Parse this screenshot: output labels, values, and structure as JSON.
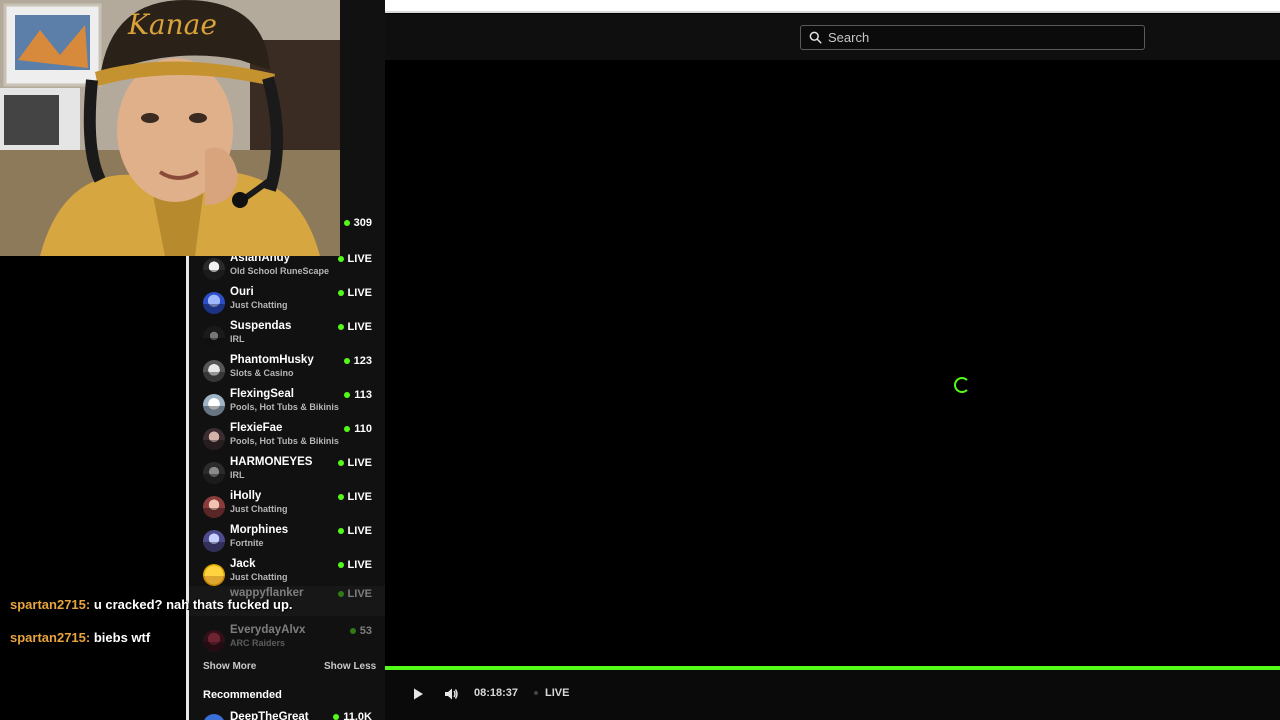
{
  "browser": {
    "url_fragment": "flanker"
  },
  "search": {
    "placeholder": "Search"
  },
  "top_row": {
    "viewers": "309",
    "dot_color": "#53fc18"
  },
  "following": [
    {
      "name": "AsianAndy",
      "category": "Old School RuneScape",
      "status": "LIVE"
    },
    {
      "name": "Ouri",
      "category": "Just Chatting",
      "status": "LIVE"
    },
    {
      "name": "Suspendas",
      "category": "IRL",
      "status": "LIVE"
    },
    {
      "name": "PhantomHusky",
      "category": "Slots & Casino",
      "status": "123"
    },
    {
      "name": "FlexingSeal",
      "category": "Pools, Hot Tubs & Bikinis",
      "status": "113"
    },
    {
      "name": "FlexieFae",
      "category": "Pools, Hot Tubs & Bikinis",
      "status": "110"
    },
    {
      "name": "HARMONEYES",
      "category": "IRL",
      "status": "LIVE"
    },
    {
      "name": "iHolly",
      "category": "Just Chatting",
      "status": "LIVE"
    },
    {
      "name": "Morphines",
      "category": "Fortnite",
      "status": "LIVE"
    },
    {
      "name": "Jack",
      "category": "Just Chatting",
      "status": "LIVE"
    },
    {
      "name": "wappyflanker",
      "category": "",
      "status": "LIVE"
    },
    {
      "name": "EverydayAlvx",
      "category": "ARC Raiders",
      "status": "53"
    }
  ],
  "sidebar": {
    "show_more": "Show More",
    "show_less": "Show Less",
    "recommended_title": "Recommended",
    "recommended": [
      {
        "name": "DeepTheGreat",
        "status": "11.0K"
      }
    ]
  },
  "chat": [
    {
      "user": "spartan2715:",
      "message": "u cracked? nah thats fucked up."
    },
    {
      "user": "spartan2715:",
      "message": "biebs wtf"
    }
  ],
  "player": {
    "time": "08:18:37",
    "live_label": "LIVE",
    "progress": 1.0,
    "accent": "#53fc18"
  }
}
